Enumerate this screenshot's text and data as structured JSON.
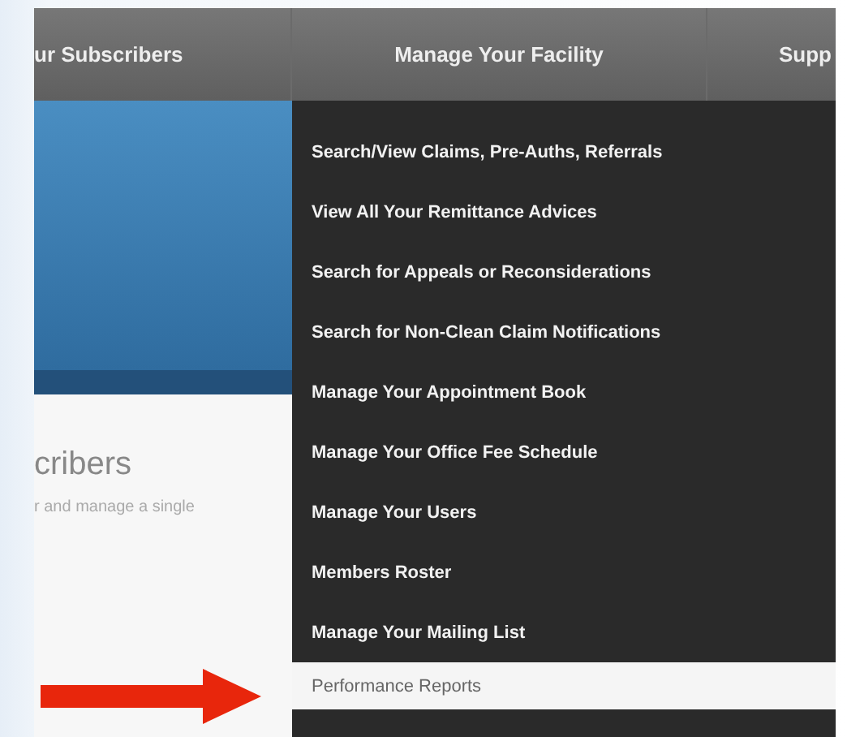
{
  "nav": [
    {
      "label": "ur Subscribers"
    },
    {
      "label": "Manage Your Facility"
    },
    {
      "label": "Supp"
    }
  ],
  "section": {
    "heading": "cribers",
    "description": "r and manage a single"
  },
  "menu": [
    {
      "label": "Search/View Claims, Pre-Auths, Referrals",
      "selected": false
    },
    {
      "label": "View All Your Remittance Advices",
      "selected": false
    },
    {
      "label": "Search for Appeals or Reconsiderations",
      "selected": false
    },
    {
      "label": "Search for Non-Clean Claim Notifications",
      "selected": false
    },
    {
      "label": "Manage Your Appointment Book",
      "selected": false
    },
    {
      "label": "Manage Your Office Fee Schedule",
      "selected": false
    },
    {
      "label": "Manage Your Users",
      "selected": false
    },
    {
      "label": "Members Roster",
      "selected": false
    },
    {
      "label": "Manage Your Mailing List",
      "selected": false
    },
    {
      "label": "Performance Reports",
      "selected": true
    }
  ]
}
